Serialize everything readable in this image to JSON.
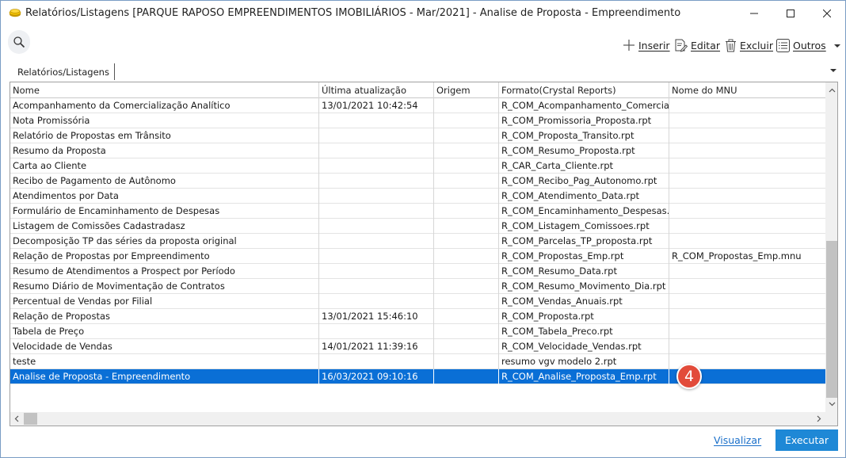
{
  "window": {
    "title": "Relatórios/Listagens [PARQUE RAPOSO EMPREENDIMENTOS IMOBILIÁRIOS - Mar/2021]  - Analise de Proposta - Empreendimento",
    "icon": "coin-stack-icon",
    "controls": {
      "minimize": "minimize-icon",
      "maximize": "maximize-icon",
      "close": "close-icon"
    }
  },
  "search": {
    "icon": "search-icon"
  },
  "toolbar": {
    "insert_label": "Inserir",
    "edit_label": "Editar",
    "delete_label": "Excluir",
    "other_label": "Outros"
  },
  "tabs": [
    {
      "label": "Relatórios/Listagens"
    }
  ],
  "grid": {
    "columns": [
      "Nome",
      "Última atualização",
      "Origem",
      "Formato(Crystal Reports)",
      "Nome do MNU"
    ],
    "rows": [
      [
        "Acompanhamento da Comercialização Analítico",
        "13/01/2021 10:42:54",
        "",
        "R_COM_Acompanhamento_Comerciali",
        ""
      ],
      [
        "Nota Promissória",
        "",
        "",
        "R_COM_Promissoria_Proposta.rpt",
        ""
      ],
      [
        "Relatório de Propostas em Trânsito",
        "",
        "",
        "R_COM_Proposta_Transito.rpt",
        ""
      ],
      [
        "Resumo da Proposta",
        "",
        "",
        "R_COM_Resumo_Proposta.rpt",
        ""
      ],
      [
        "Carta ao Cliente",
        "",
        "",
        "R_CAR_Carta_Cliente.rpt",
        ""
      ],
      [
        "Recibo de Pagamento de Autônomo",
        "",
        "",
        "R_COM_Recibo_Pag_Autonomo.rpt",
        ""
      ],
      [
        "Atendimentos por Data",
        "",
        "",
        "R_COM_Atendimento_Data.rpt",
        ""
      ],
      [
        "Formulário de Encaminhamento de Despesas",
        "",
        "",
        "R_COM_Encaminhamento_Despesas.rp",
        ""
      ],
      [
        "Listagem de Comissões Cadastradasz",
        "",
        "",
        "R_COM_Listagem_Comissoes.rpt",
        ""
      ],
      [
        "Decomposição TP das séries da proposta original",
        "",
        "",
        "R_COM_Parcelas_TP_proposta.rpt",
        ""
      ],
      [
        "Relação de Propostas por Empreendimento",
        "",
        "",
        "R_COM_Propostas_Emp.rpt",
        "R_COM_Propostas_Emp.mnu"
      ],
      [
        "Resumo de Atendimentos a Prospect por Período",
        "",
        "",
        "R_COM_Resumo_Data.rpt",
        ""
      ],
      [
        "Resumo Diário de Movimentação de Contratos",
        "",
        "",
        "R_COM_Resumo_Movimento_Dia.rpt",
        ""
      ],
      [
        "Percentual de Vendas por Filial",
        "",
        "",
        "R_COM_Vendas_Anuais.rpt",
        ""
      ],
      [
        "Relação de Propostas",
        "13/01/2021 15:46:10",
        "",
        "R_COM_Proposta.rpt",
        ""
      ],
      [
        "Tabela de Preço",
        "",
        "",
        "R_COM_Tabela_Preco.rpt",
        ""
      ],
      [
        "Velocidade de Vendas",
        "14/01/2021 11:39:16",
        "",
        "R_COM_Velocidade_Vendas.rpt",
        ""
      ],
      [
        "teste",
        "",
        "",
        "resumo vgv modelo 2.rpt",
        ""
      ],
      [
        "Analise de Proposta - Empreendimento",
        "16/03/2021 09:10:16",
        "",
        "R_COM_Analise_Proposta_Emp.rpt",
        ""
      ]
    ],
    "selected_row": 18
  },
  "badge": {
    "label": "4",
    "color": "#e24b3a"
  },
  "footer": {
    "view_label": "Visualizar",
    "execute_label": "Executar"
  },
  "colors": {
    "accent": "#1e88d6",
    "selection": "#0a6fd6",
    "link": "#1a6fc9"
  }
}
